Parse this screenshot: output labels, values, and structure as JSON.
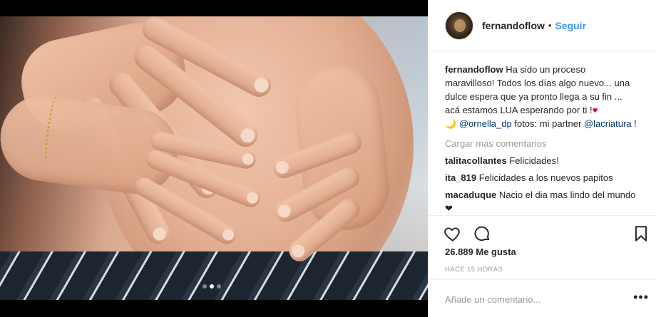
{
  "post": {
    "username": "fernandoflow",
    "separator": "•",
    "follow_label": "Seguir",
    "caption_user": "fernandoflow",
    "caption_text": " Ha sido un proceso maravilloso! Todos los días algo nuevo... una dulce espera que ya pronto llega a su fin ... acá estamos LUA esperando por ti !",
    "caption_heart": "♥",
    "caption_moon": "🌙",
    "mention_1": "@ornella_dp",
    "caption_mid": " fotos: mi partner ",
    "mention_2": "@lacriatura",
    "caption_end": " !",
    "load_more_label": "Cargar más comentarios",
    "comments": [
      {
        "user": "talitacollantes",
        "text": "Felicidades!"
      },
      {
        "user": "ita_819",
        "text": "Felicidades a los nuevos papitos"
      },
      {
        "user": "macaduque",
        "text": "Nacio el dia mas lindo del mundo ❤"
      }
    ],
    "likes": "26.889 Me gusta",
    "time_ago": "HACE 15 HORAS",
    "comment_placeholder": "Añade un comentario...",
    "more_label": "•••"
  },
  "carousel": {
    "count": 3,
    "active_index": 1
  },
  "icons": [
    "heart-icon",
    "comment-icon",
    "bookmark-icon"
  ],
  "colors": {
    "link_blue": "#3897f0",
    "mention": "#003569",
    "muted": "#999999"
  }
}
